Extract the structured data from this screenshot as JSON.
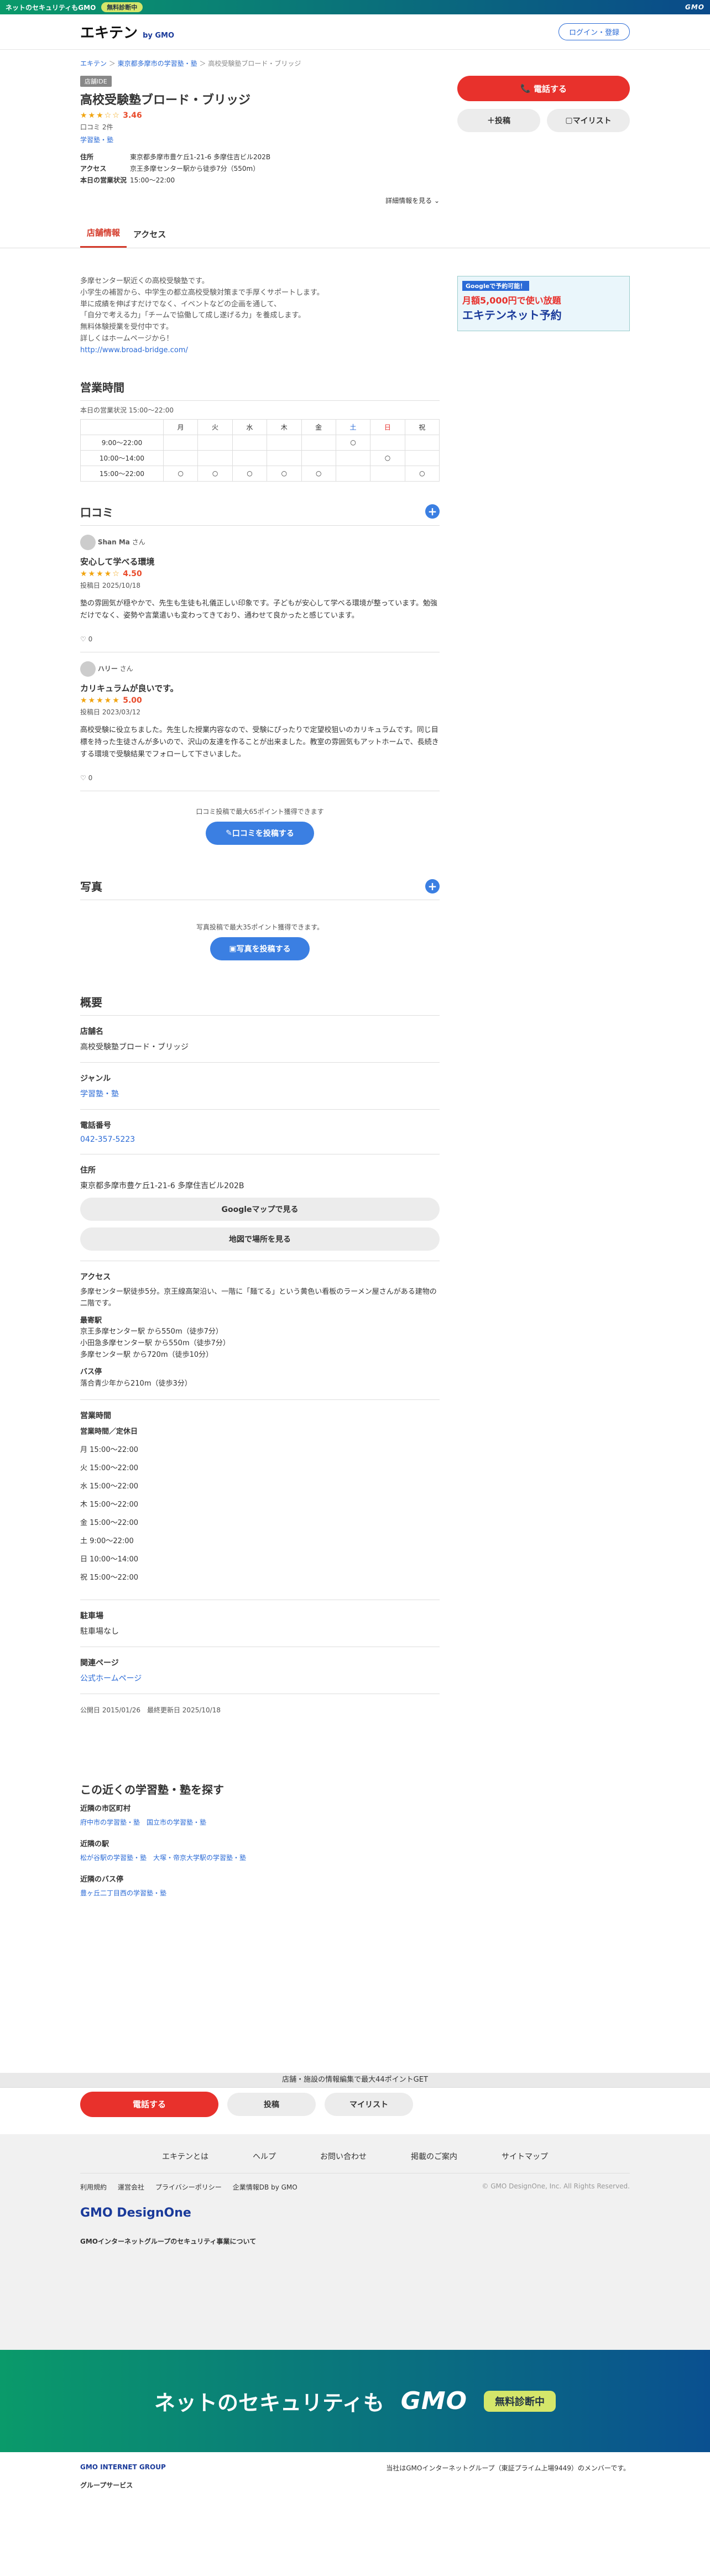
{
  "topbar": {
    "text": "ネットのセキュリティもGMO",
    "badge": "無料診断中",
    "right": "ネットのセキュリティもGMO"
  },
  "header": {
    "logo": "エキテン",
    "logo_sub": "by GMO",
    "login": "ログイン・登録"
  },
  "breadcrumb": [
    "エキテン",
    "東京都多摩市の学習塾・塾",
    "高校受験塾ブロード・ブリッジ"
  ],
  "shop": {
    "tag": "店舗IDE",
    "name": "高校受験塾ブロード・ブリッジ",
    "stars": "★★★☆☆",
    "rating": "3.46",
    "reviews": "口コミ 2件",
    "genre": "学習塾・塾",
    "address_label": "住所",
    "address": "東京都多摩市豊ケ丘1-21-6 多摩住吉ビル202B",
    "access_label": "アクセス",
    "access": "京王多摩センター駅から徒歩7分（550m）",
    "hours_label": "本日の営業状況",
    "hours": "15:00〜22:00",
    "more": "詳細情報を見る"
  },
  "actions": {
    "call": "電話する",
    "post": "投稿",
    "mylist": "マイリスト"
  },
  "tabs": [
    "店舗情報",
    "アクセス"
  ],
  "intro": [
    "多摩センター駅近くの高校受験塾です。",
    "小学生の補習から、中学生の都立高校受験対策まで手厚くサポートします。",
    "単に成績を伸ばすだけでなく、イベントなどの企画を通して、",
    "「自分で考える力」「チームで協働して成し遂げる力」を養成します。",
    "無料体験授業を受付中です。",
    "詳しくはホームページから！",
    "http://www.broad-bridge.com/"
  ],
  "banner": {
    "line1": "Googleで予約可能！",
    "line2": "月額5,000円で使い放題",
    "line3": "エキテンネット予約"
  },
  "hours_section": {
    "title": "営業時間",
    "today": "本日の営業状況 15:00〜22:00",
    "days": [
      "月",
      "火",
      "水",
      "木",
      "金",
      "土",
      "日",
      "祝"
    ],
    "rows": [
      {
        "time": "9:00〜22:00",
        "marks": [
          "",
          "",
          "",
          "",
          "",
          "○",
          "",
          ""
        ]
      },
      {
        "time": "10:00〜14:00",
        "marks": [
          "",
          "",
          "",
          "",
          "",
          "",
          "○",
          ""
        ]
      },
      {
        "time": "15:00〜22:00",
        "marks": [
          "○",
          "○",
          "○",
          "○",
          "○",
          "",
          "",
          "○"
        ]
      }
    ]
  },
  "reviews": {
    "title": "口コミ",
    "items": [
      {
        "user": "Shan Ma",
        "title": "安心して学べる環境",
        "stars": "★★★★☆",
        "score": "4.50",
        "date": "投稿日 2025/10/18",
        "body": "塾の雰囲気が穏やかで、先生も生徒も礼儀正しい印象です。子どもが安心して学べる環境が整っています。勉強だけでなく、姿勢や言葉遣いも変わってきており、通わせて良かったと感じています。",
        "likes": "0"
      },
      {
        "user": "ハリー",
        "title": "カリキュラムが良いです。",
        "stars": "★★★★★",
        "score": "5.00",
        "date": "投稿日 2023/03/12",
        "body": "高校受験に役立ちました。先生した授業内容なので、受験にぴったりで定望校狙いのカリキュラムです。同じ目標を持った生徒さんが多いので、沢山の友達を作ることが出来ました。教室の雰囲気もアットホームで、長続きする環境で受験結果でフォローして下さいました。",
        "likes": "0"
      }
    ],
    "cta_note": "口コミ投稿で最大65ポイント獲得できます",
    "cta": "口コミを投稿する"
  },
  "photos": {
    "title": "写真",
    "note": "写真投稿で最大35ポイント獲得できます。",
    "cta": "写真を投稿する"
  },
  "overview": {
    "title": "概要",
    "name_l": "店舗名",
    "name": "高校受験塾ブロード・ブリッジ",
    "genre_l": "ジャンル",
    "genre": "学習塾・塾",
    "tel_l": "電話番号",
    "tel": "042-357-5223",
    "addr_l": "住所",
    "addr": "東京都多摩市豊ケ丘1-21-6 多摩住吉ビル202B",
    "gmap": "Googleマップで見る",
    "map": "地図で場所を見る",
    "access_l": "アクセス",
    "access": "多摩センター駅徒歩5分。京王線高架沿い、一階に「麺てる」という黄色い看板のラーメン屋さんがある建物の二階です。",
    "station_l": "最寄駅",
    "stations": [
      "京王多摩センター駅 から550m（徒歩7分）",
      "小田急多摩センター駅 から550m（徒歩7分）",
      "多摩センター駅 から720m（徒歩10分）"
    ],
    "bus_l": "バス停",
    "bus": "落合青少年から210m（徒歩3分）",
    "biz_l": "営業時間",
    "biz_sub": "営業時間／定休日",
    "biz": [
      "月 15:00〜22:00",
      "火 15:00〜22:00",
      "水 15:00〜22:00",
      "木 15:00〜22:00",
      "金 15:00〜22:00",
      "土 9:00〜22:00",
      "日 10:00〜14:00",
      "祝 15:00〜22:00"
    ],
    "parking_l": "駐車場",
    "parking": "駐車場なし",
    "rel_l": "関連ページ",
    "rel": "公式ホームページ"
  },
  "published": "公開日 2015/01/26　最終更新日 2025/10/18",
  "nearby": {
    "title": "この近くの学習塾・塾を探す",
    "city_l": "近隣の市区町村",
    "city": "府中市の学習塾・塾　国立市の学習塾・塾",
    "st_l": "近隣の駅",
    "st": "松が谷駅の学習塾・塾　大塚・帝京大学駅の学習塾・塾",
    "bus_l": "近隣のバス停",
    "bus": "豊ヶ丘二丁目西の学習塾・塾"
  },
  "strip": "店舗・施設の情報編集で最大44ポイントGET",
  "footer": {
    "links": [
      "エキテンとは",
      "ヘルプ",
      "お問い合わせ",
      "掲載のご案内",
      "サイトマップ"
    ],
    "sub": [
      "利用規約",
      "運営会社",
      "プライバシーポリシー",
      "企業情報DB by GMO"
    ],
    "copy": "© GMO DesignOne, Inc. All Rights Reserved.",
    "brand": "GMO DesignOne",
    "security": "GMOインターネットグループのセキュリティ事業について"
  },
  "promo": {
    "text": "ネットのセキュリティも",
    "gmo": "GMO",
    "btn": "無料診断中"
  },
  "group": {
    "name": "GMO INTERNET GROUP",
    "note": "当社はGMOインターネットグループ（東証プライム上場9449）のメンバーです。",
    "label": "グループサービス"
  }
}
